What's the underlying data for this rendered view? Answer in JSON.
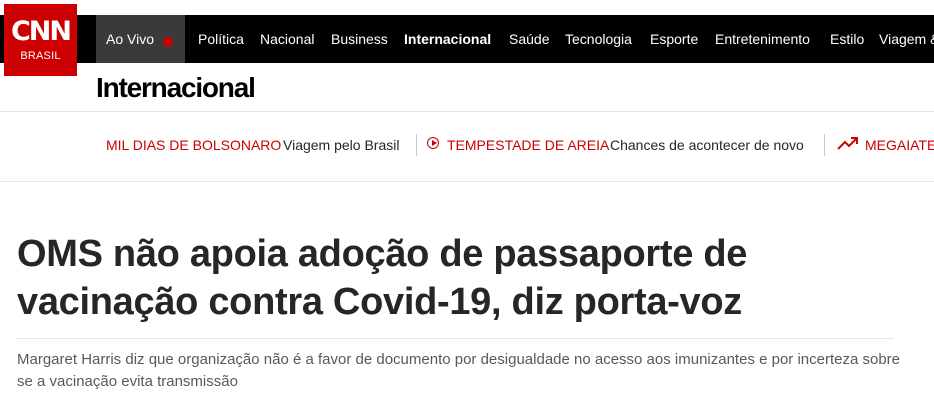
{
  "logo": {
    "name": "CNN",
    "sub": "BRASIL"
  },
  "nav": {
    "live_label": "Ao Vivo",
    "items": [
      {
        "label": "Política"
      },
      {
        "label": "Nacional"
      },
      {
        "label": "Business"
      },
      {
        "label": "Internacional",
        "active": true
      },
      {
        "label": "Saúde"
      },
      {
        "label": "Tecnologia"
      },
      {
        "label": "Esporte"
      },
      {
        "label": "Entretenimento"
      },
      {
        "label": "Estilo"
      },
      {
        "label": "Viagem &"
      }
    ]
  },
  "section": {
    "title": "Internacional"
  },
  "trending": [
    {
      "tag": "MIL DIAS DE BOLSONARO",
      "text": "Viagem pelo Brasil"
    },
    {
      "tag": "TEMPESTADE DE AREIA",
      "text": "Chances de acontecer de novo",
      "icon": "play-circle-icon"
    },
    {
      "tag": "MEGAIATE",
      "icon": "trending-up-icon"
    }
  ],
  "article": {
    "headline": "OMS não apoia adoção de passaporte de vacinação contra Covid-19, diz porta-voz",
    "subtitle": "Margaret Harris diz que organização não é a favor de documento por desigualdade no acesso aos imunizantes e por incerteza sobre se a vacinação evita transmissão"
  },
  "colors": {
    "brand_red": "#cc0000",
    "nav_bg": "#000000",
    "live_bg": "#3a3a3a"
  }
}
